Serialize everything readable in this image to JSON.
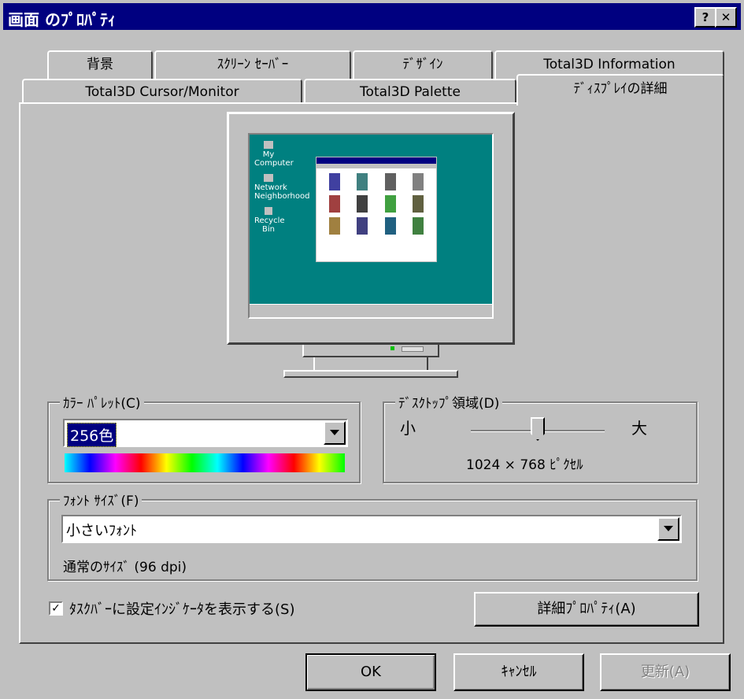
{
  "window": {
    "title": "画面 のﾌﾟﾛﾊﾟﾃｨ",
    "help_label": "?",
    "close_label": "✕"
  },
  "tabs": {
    "row1": [
      "背景",
      "ｽｸﾘｰﾝ ｾｰﾊﾞｰ",
      "ﾃﾞｻﾞｲﾝ",
      "Total3D Information"
    ],
    "row2": [
      "Total3D Cursor/Monitor",
      "Total3D Palette",
      "ﾃﾞｨｽﾌﾟﾚｲの詳細"
    ],
    "active": "ﾃﾞｨｽﾌﾟﾚｲの詳細"
  },
  "preview": {
    "desktop_icons": [
      "My Computer",
      "Network Neighborhood",
      "Recycle Bin"
    ],
    "window_icons_count": 12
  },
  "color_palette": {
    "group_label": "ｶﾗｰ ﾊﾟﾚｯﾄ(C)",
    "selected": "256色"
  },
  "desktop_area": {
    "group_label": "ﾃﾞｽｸﾄｯﾌﾟ領域(D)",
    "min_label": "小",
    "max_label": "大",
    "resolution_text": "1024 × 768 ﾋﾟｸｾﾙ",
    "slider_fraction": 0.5
  },
  "font_size": {
    "group_label": "ﾌｫﾝﾄ ｻｲｽﾞ(F)",
    "selected": "小さいﾌｫﾝﾄ",
    "info_text": "通常のｻｲｽﾞ (96 dpi)"
  },
  "taskbar_indicator": {
    "label": "ﾀｽｸﾊﾞｰに設定ｲﾝｼﾞｹｰﾀを表示する(S)",
    "checked": true
  },
  "buttons": {
    "advanced": "詳細ﾌﾟﾛﾊﾟﾃｨ(A)",
    "ok": "OK",
    "cancel": "ｷｬﾝｾﾙ",
    "apply": "更新(A)"
  },
  "colors": {
    "titlebar": "#000080",
    "face": "#c0c0c0",
    "desktop": "#008080",
    "selection": "#000080"
  }
}
